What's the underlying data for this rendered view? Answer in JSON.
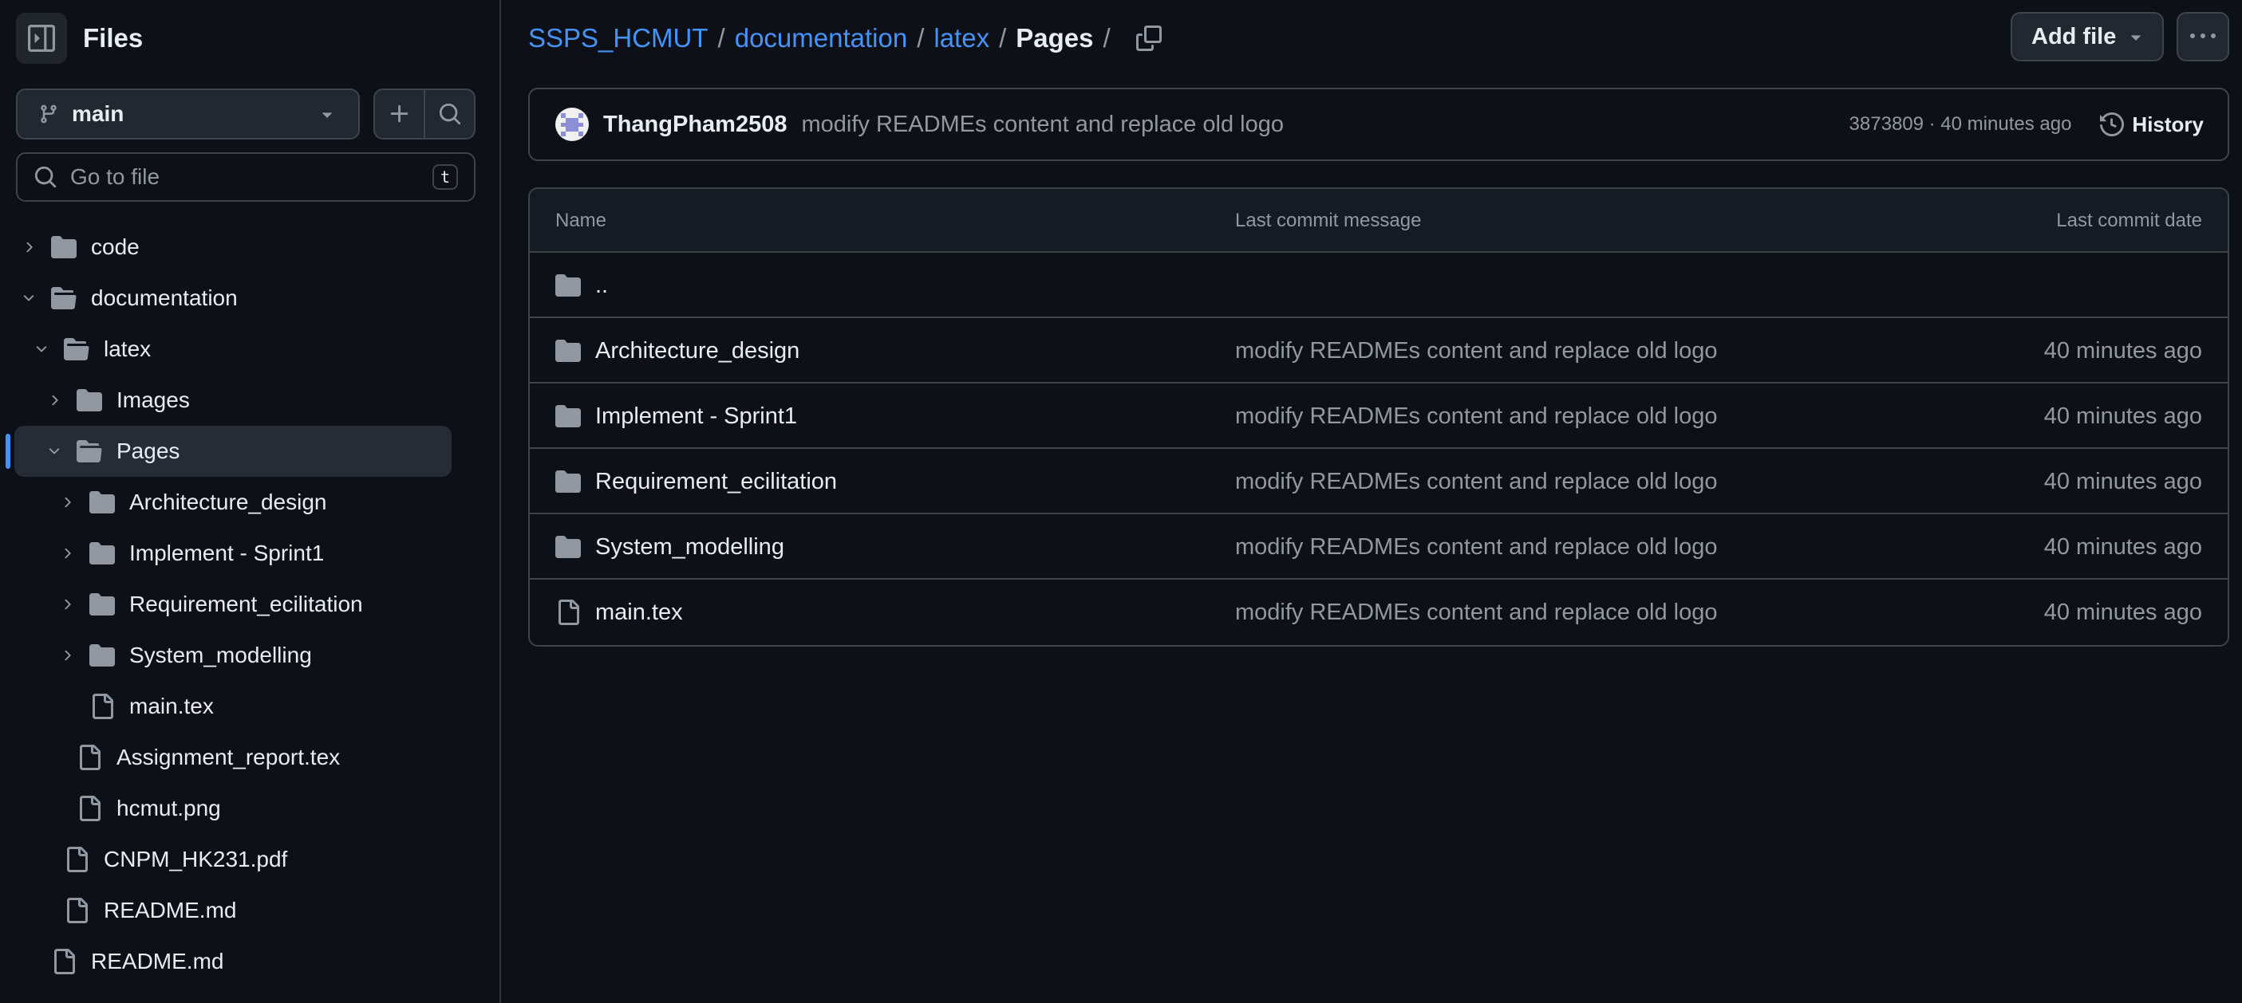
{
  "sidebar": {
    "title": "Files",
    "branch": "main",
    "goto_placeholder": "Go to file",
    "goto_shortcut": "t",
    "tree": [
      {
        "label": "code",
        "type": "folder",
        "depth": 0,
        "expanded": false
      },
      {
        "label": "documentation",
        "type": "folder",
        "depth": 0,
        "expanded": true
      },
      {
        "label": "latex",
        "type": "folder",
        "depth": 1,
        "expanded": true
      },
      {
        "label": "Images",
        "type": "folder",
        "depth": 2,
        "expanded": false
      },
      {
        "label": "Pages",
        "type": "folder",
        "depth": 2,
        "expanded": true,
        "selected": true
      },
      {
        "label": "Architecture_design",
        "type": "folder",
        "depth": 3,
        "expanded": false
      },
      {
        "label": "Implement - Sprint1",
        "type": "folder",
        "depth": 3,
        "expanded": false
      },
      {
        "label": "Requirement_ecilitation",
        "type": "folder",
        "depth": 3,
        "expanded": false
      },
      {
        "label": "System_modelling",
        "type": "folder",
        "depth": 3,
        "expanded": false
      },
      {
        "label": "main.tex",
        "type": "file",
        "depth": 3
      },
      {
        "label": "Assignment_report.tex",
        "type": "file",
        "depth": 2
      },
      {
        "label": "hcmut.png",
        "type": "file",
        "depth": 2
      },
      {
        "label": "CNPM_HK231.pdf",
        "type": "file",
        "depth": 1
      },
      {
        "label": "README.md",
        "type": "file",
        "depth": 1
      },
      {
        "label": "README.md",
        "type": "file",
        "depth": 0
      }
    ]
  },
  "breadcrumb": {
    "links": [
      "SSPS_HCMUT",
      "documentation",
      "latex"
    ],
    "separator": "/",
    "current": "Pages"
  },
  "toolbar": {
    "add_file_label": "Add file"
  },
  "commit": {
    "author": "ThangPham2508",
    "message": "modify READMEs content and replace old logo",
    "meta": "3873809 · 40 minutes ago",
    "history_label": "History"
  },
  "table": {
    "columns": [
      "Name",
      "Last commit message",
      "Last commit date"
    ],
    "parent_label": "..",
    "rows": [
      {
        "name": "Architecture_design",
        "type": "folder",
        "message": "modify READMEs content and replace old logo",
        "date": "40 minutes ago"
      },
      {
        "name": "Implement - Sprint1",
        "type": "folder",
        "message": "modify READMEs content and replace old logo",
        "date": "40 minutes ago"
      },
      {
        "name": "Requirement_ecilitation",
        "type": "folder",
        "message": "modify READMEs content and replace old logo",
        "date": "40 minutes ago"
      },
      {
        "name": "System_modelling",
        "type": "folder",
        "message": "modify READMEs content and replace old logo",
        "date": "40 minutes ago"
      },
      {
        "name": "main.tex",
        "type": "file",
        "message": "modify READMEs content and replace old logo",
        "date": "40 minutes ago"
      }
    ]
  },
  "colors": {
    "background": "#0d1117",
    "accent": "#4493f8",
    "border": "#3d444d",
    "muted_text": "#9198a1",
    "selected_bg": "#262c36"
  }
}
